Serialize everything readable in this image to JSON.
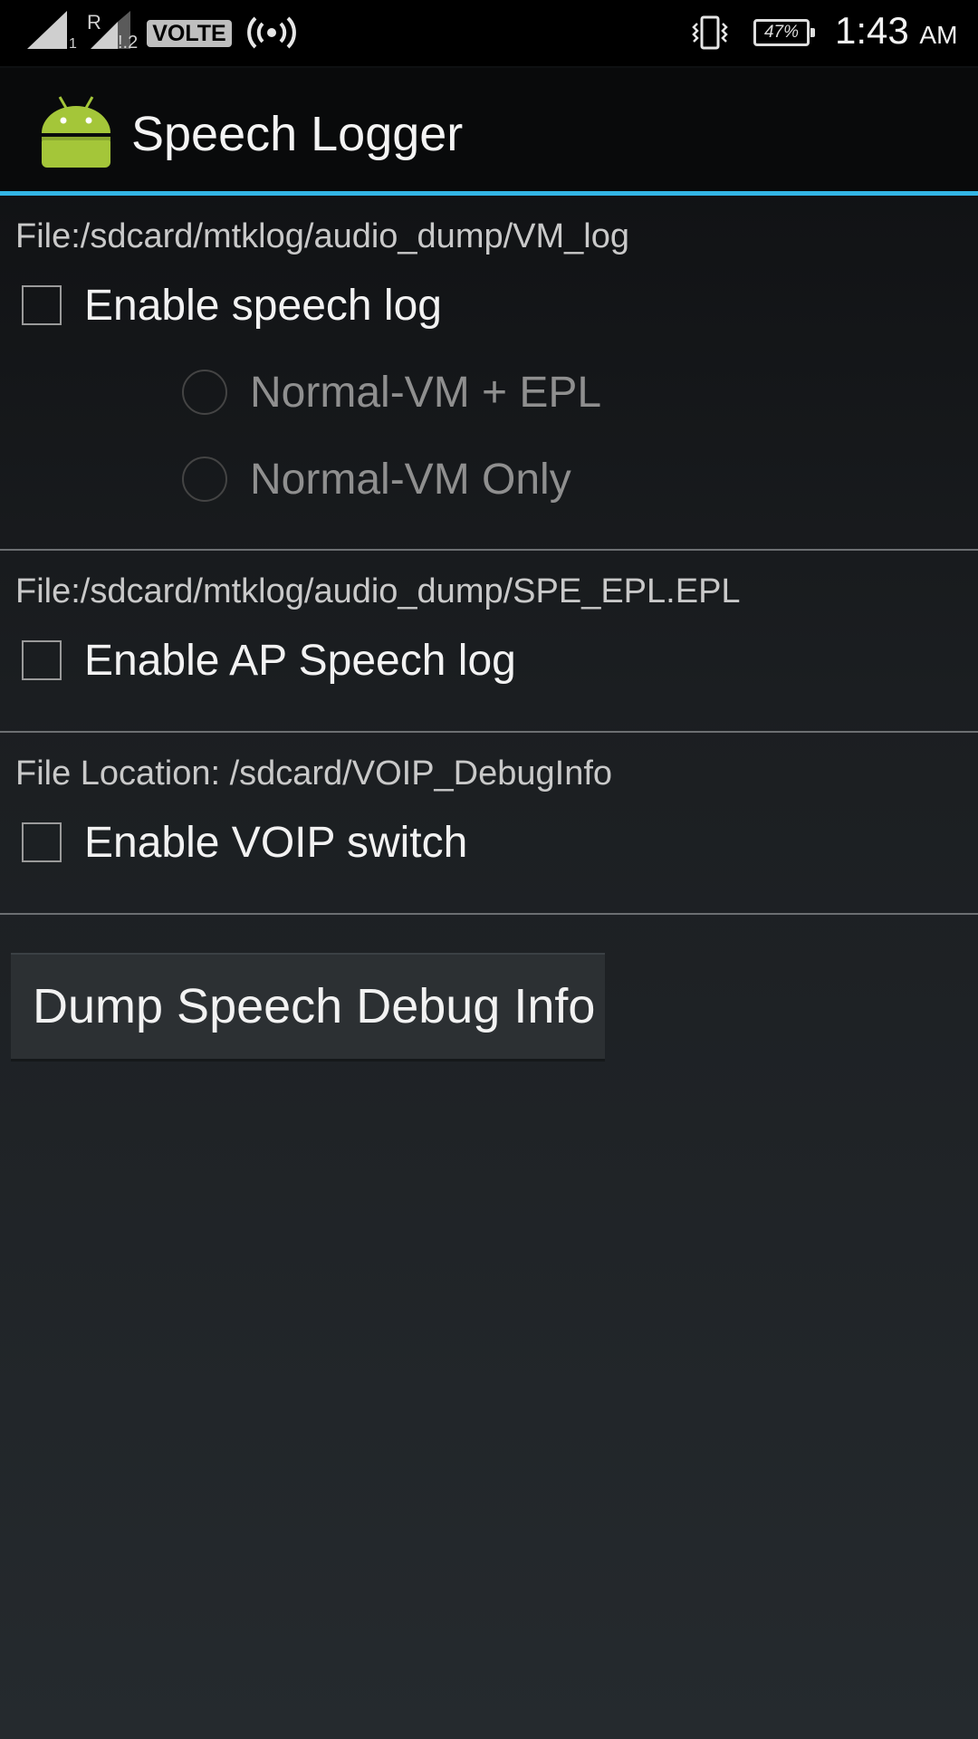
{
  "status_bar": {
    "sim1_label": "1",
    "sim2_roaming": "R",
    "sim2_label": "!.2",
    "volte": "VOLTE",
    "battery_percent": "47%",
    "time": "1:43",
    "ampm": "AM",
    "icons": [
      "signal-icon",
      "signal-icon",
      "hotspot-icon",
      "vibrate-icon",
      "battery-icon"
    ]
  },
  "action_bar": {
    "title": "Speech Logger",
    "icon": "android-icon"
  },
  "sections": {
    "speech_log": {
      "path": "File:/sdcard/mtklog/audio_dump/VM_log",
      "checkbox_label": "Enable speech log",
      "checked": false,
      "options": [
        {
          "label": "Normal-VM + EPL",
          "selected": false,
          "enabled": false
        },
        {
          "label": "Normal-VM Only",
          "selected": false,
          "enabled": false
        }
      ]
    },
    "ap_speech_log": {
      "path": "File:/sdcard/mtklog/audio_dump/SPE_EPL.EPL",
      "checkbox_label": "Enable AP Speech log",
      "checked": false
    },
    "voip": {
      "path": "File Location: /sdcard/VOIP_DebugInfo",
      "checkbox_label": "Enable VOIP switch",
      "checked": false
    }
  },
  "dump_button_label": "Dump Speech Debug Info",
  "colors": {
    "accent": "#33b5e5",
    "android_green": "#a4c639"
  }
}
